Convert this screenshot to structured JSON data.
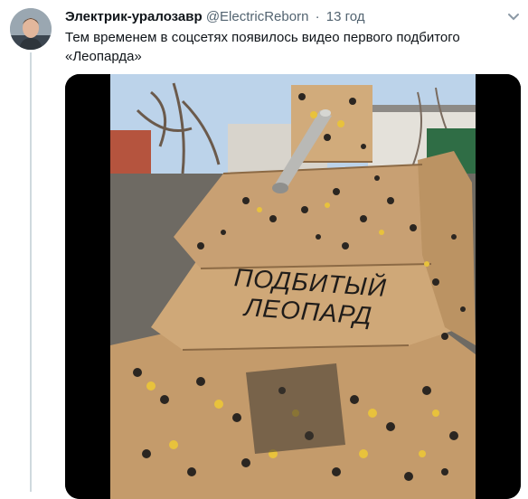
{
  "tweet": {
    "author_name": "Электрик-уралозавр",
    "author_handle": "@ElectricReborn",
    "separator": "·",
    "time": "13 год",
    "text": "Тем временем в соцсетях появилось видео первого подбитого «Леопарда»"
  },
  "media": {
    "painted_text_line1": "ПОДБИТЫЙ",
    "painted_text_line2": "ЛЕОПАРД"
  },
  "icons": {
    "more": "chevron-down-icon"
  },
  "colors": {
    "cardboard": "#c9a272",
    "spots_dark": "#2b2621",
    "spots_yellow": "#e8c23c",
    "sky": "#bcd3ea",
    "handle_gray": "#536471"
  }
}
